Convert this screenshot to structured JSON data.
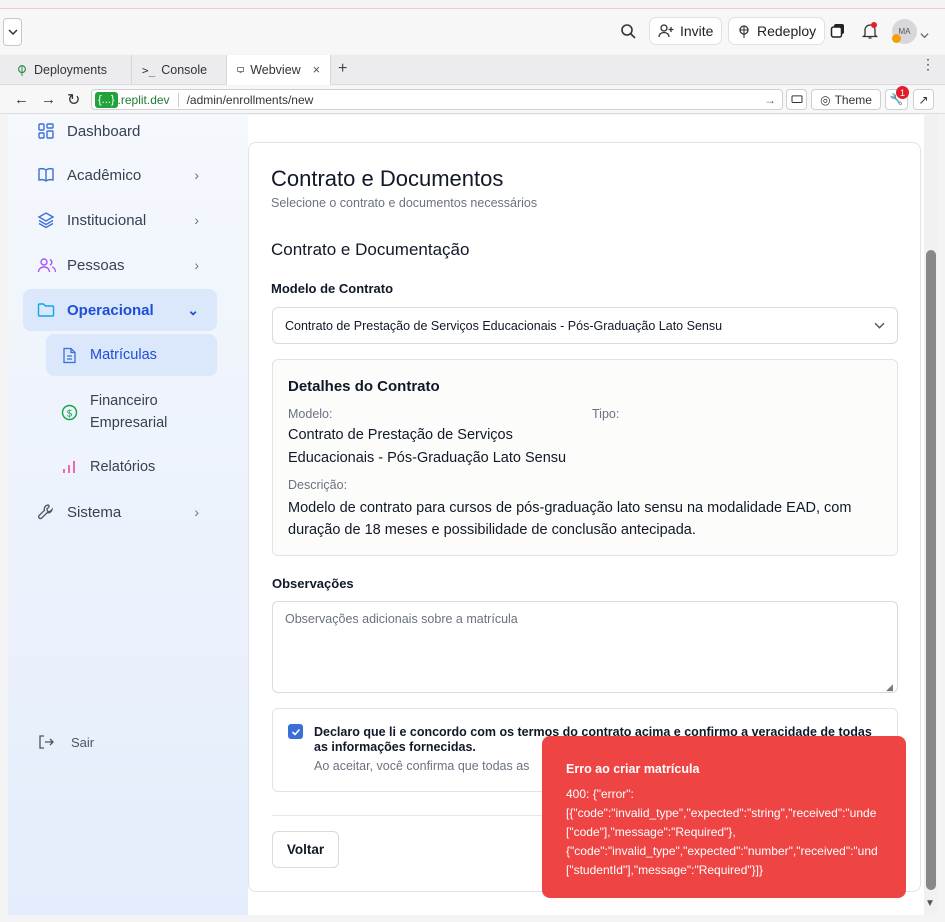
{
  "topbar": {
    "invite": "Invite",
    "redeploy": "Redeploy",
    "avatar": "MA"
  },
  "tabs": [
    {
      "label": "Deployments"
    },
    {
      "label": "Console"
    },
    {
      "label": "Webview",
      "close": "×"
    }
  ],
  "tabs_add": "+",
  "browser": {
    "url_host_badge": "{...}",
    "url_host": ".replit.dev",
    "url_path": "/admin/enrollments/new",
    "theme": "Theme",
    "badge_count": "1"
  },
  "sidebar": {
    "items": [
      {
        "label": "Dashboard"
      },
      {
        "label": "Acadêmico"
      },
      {
        "label": "Institucional"
      },
      {
        "label": "Pessoas"
      },
      {
        "label": "Operacional"
      },
      {
        "label": "Sistema"
      }
    ],
    "sub_items": [
      {
        "label": "Matrículas"
      },
      {
        "label": "Financeiro Empresarial"
      },
      {
        "label": "Relatórios"
      }
    ],
    "logout": "Sair"
  },
  "page": {
    "title": "Contrato e Documentos",
    "subtitle": "Selecione o contrato e documentos necessários",
    "section_title": "Contrato e Documentação",
    "contract_label": "Modelo de Contrato",
    "contract_value": "Contrato de Prestação de Serviços Educacionais - Pós-Graduação Lato Sensu",
    "details": {
      "title": "Detalhes do Contrato",
      "model_label": "Modelo:",
      "model_value_1": "Contrato de Prestação de Serviços",
      "model_value_2": "Educacionais - Pós-Graduação Lato Sensu",
      "type_label": "Tipo:",
      "desc_label": "Descrição:",
      "desc_value": "Modelo de contrato para cursos de pós-graduação lato sensu na modalidade EAD, com duração de 18 meses e possibilidade de conclusão antecipada."
    },
    "notes_label": "Observações",
    "notes_placeholder": "Observações adicionais sobre a matrícula",
    "consent_text": "Declaro que li e concordo com os termos do contrato acima e confirmo a veracidade de todas as informações fornecidas.",
    "consent_hint": "Ao aceitar, você confirma que todas as",
    "back_button": "Voltar"
  },
  "toast": {
    "title": "Erro ao criar matrícula",
    "lines": [
      "400: {\"error\":",
      "[{\"code\":\"invalid_type\",\"expected\":\"string\",\"received\":\"unde",
      "[\"code\"],\"message\":\"Required\"},",
      "{\"code\":\"invalid_type\",\"expected\":\"number\",\"received\":\"und",
      "[\"studentId\"],\"message\":\"Required\"}]}"
    ]
  },
  "colors": {
    "accent": "#1d4ed8",
    "toast": "#ef4444",
    "checkbox": "#3b6fd8"
  }
}
